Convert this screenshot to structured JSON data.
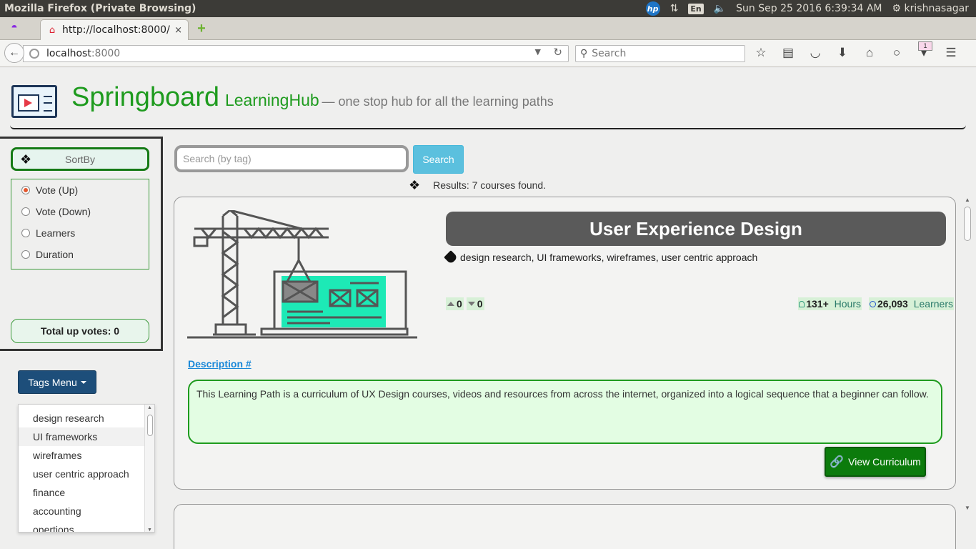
{
  "os": {
    "window_title": "Mozilla Firefox (Private Browsing)",
    "hp_label": "hp",
    "lang": "En",
    "clock": "Sun Sep 25 2016  6:39:34 AM",
    "user": "krishnasagar"
  },
  "browser": {
    "tab_title": "http://localhost:8000/",
    "tab_close": "×",
    "new_tab": "+",
    "url_host": "localhost",
    "url_port": ":8000",
    "search_placeholder": "Search",
    "notification_count": "1"
  },
  "header": {
    "brand": "Springboard",
    "sub": "LearningHub",
    "tagline": "— one stop hub for all the learning paths"
  },
  "sidebar": {
    "sortby_label": "SortBy",
    "sort_options": [
      "Vote (Up)",
      "Vote (Down)",
      "Learners",
      "Duration"
    ],
    "selected_sort": "Vote (Up)",
    "total_votes": "Total up votes: 0",
    "tags_menu_label": "Tags Menu",
    "tags": [
      "design research",
      "UI frameworks",
      "wireframes",
      "user centric approach",
      "finance",
      "accounting",
      "opertions"
    ],
    "hovered_tag": "UI frameworks"
  },
  "search": {
    "placeholder": "Search (by tag)",
    "button": "Search",
    "results": "Results: 7 courses found."
  },
  "course": {
    "title": "User Experience Design",
    "tags": "design research, UI frameworks, wireframes, user centric approach",
    "up_votes": "0",
    "down_votes": "0",
    "hours_value": "131+",
    "hours_label": "Hours",
    "learners_value": "26,093",
    "learners_label": "Learners",
    "description_link": "Description #",
    "description": "This Learning Path is a curriculum of UX Design courses, videos and resources from across the internet, organized into a logical sequence that a beginner can follow.",
    "view_button": "View Curriculum"
  },
  "colors": {
    "brand_green": "#1e9b1e",
    "tags_button": "#1d4e7a",
    "search_button": "#5bc0de",
    "title_bar": "#5a5a5a",
    "description_bg": "#e3fde3",
    "view_button": "#0c7b0c",
    "illustration_screen": "#1de9b6"
  },
  "icons": [
    "mask-icon",
    "home-icon",
    "back-icon",
    "globe-icon",
    "reload-icon",
    "search-icon",
    "star-icon",
    "reader-icon",
    "pocket-icon",
    "download-icon",
    "home-icon",
    "chat-icon",
    "menu-icon",
    "layers-icon",
    "tag-icon",
    "link-icon"
  ]
}
